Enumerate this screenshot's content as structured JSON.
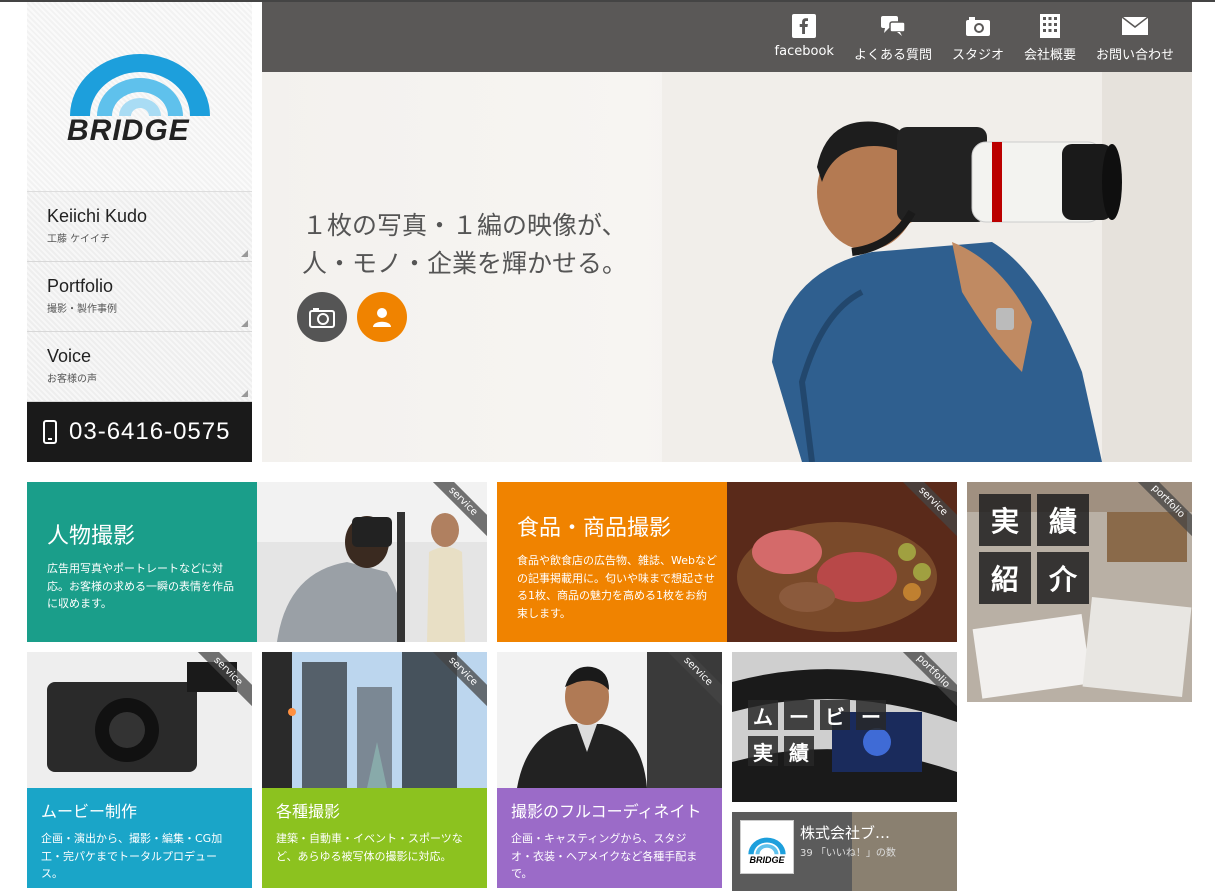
{
  "brand": {
    "logo_text": "BRIDGE"
  },
  "sidebar": {
    "items": [
      {
        "title": "Keiichi Kudo",
        "sub": "工藤 ケイイチ"
      },
      {
        "title": "Portfolio",
        "sub": "撮影・製作事例"
      },
      {
        "title": "Voice",
        "sub": "お客様の声"
      }
    ],
    "phone": "03-6416-0575"
  },
  "header": {
    "nav": [
      {
        "label": "facebook",
        "icon": "facebook-icon"
      },
      {
        "label": "よくある質問",
        "icon": "chat-bubble-icon"
      },
      {
        "label": "スタジオ",
        "icon": "camera-icon"
      },
      {
        "label": "会社概要",
        "icon": "building-icon"
      },
      {
        "label": "お問い合わせ",
        "icon": "mail-icon"
      }
    ]
  },
  "hero": {
    "line1": "１枚の写真・１編の映像が、",
    "line2": "人・モノ・企業を輝かせる。"
  },
  "tiles": {
    "person": {
      "title": "人物撮影",
      "body": "広告用写真やポートレートなどに対応。お客様の求める一瞬の表情を作品に収めます。",
      "ribbon": "service",
      "color": "#1a9e8a"
    },
    "food": {
      "title": "食品・商品撮影",
      "body": "食品や飲食店の広告物、雑誌、Webなどの記事掲載用に。匂いや味まで想起させる1枚、商品の魅力を高める1枚をお約束します。",
      "ribbon": "service",
      "color": "#f08300"
    },
    "works": {
      "k1": "実",
      "k2": "績",
      "k3": "紹",
      "k4": "介",
      "ribbon": "portfolio"
    },
    "movie": {
      "title": "ムービー制作",
      "body": "企画・演出から、撮影・編集・CG加工・完パケまでトータルプロデュース。",
      "ribbon": "service",
      "color": "#1aa5c8"
    },
    "various": {
      "title": "各種撮影",
      "body": "建築・自動車・イベント・スポーツなど、あらゆる被写体の撮影に対応。",
      "ribbon": "service",
      "color": "#8cc21f"
    },
    "coordinate": {
      "title": "撮影のフルコーディネイト",
      "body": "企画・キャスティングから、スタジオ・衣装・ヘアメイクなど各種手配まで。",
      "ribbon": "service",
      "color": "#9b6bc8"
    },
    "movie_works": {
      "m1": "ム",
      "m2": "ー",
      "m3": "ビ",
      "m4": "ー",
      "m5": "実",
      "m6": "績",
      "ribbon": "portfolio"
    }
  },
  "facebook_widget": {
    "title": "株式会社ブ…",
    "likes": "39 「いいね！」の数",
    "logo_text": "BRIDGE"
  }
}
